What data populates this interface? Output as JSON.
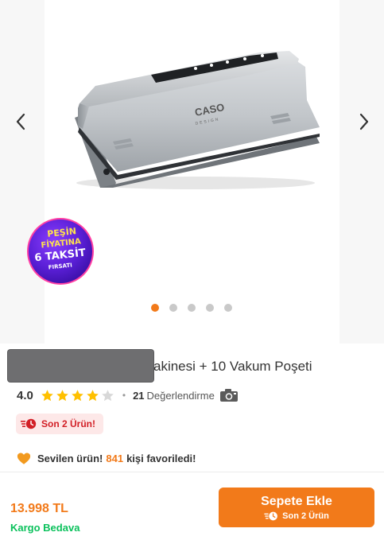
{
  "gallery": {
    "prev_icon": "chevron-left-icon",
    "next_icon": "chevron-right-icon",
    "product_logo": "CASO",
    "product_logo_sub": "DESIGN",
    "badge": {
      "line1": "PEŞİN",
      "line2": "FİYATINA",
      "line3": "6 TAKSİT",
      "line4": "FIRSATI"
    },
    "dots_total": 5,
    "active_dot": 0
  },
  "product": {
    "title_visible": "akinesi + 10 Vakum Poşeti",
    "rating": "4.0",
    "rating_value": 4,
    "review_count": "21",
    "review_label": "Değerlendirme",
    "stock_label": "Son 2 Ürün!",
    "fav_prefix": "Sevilen ürün!",
    "fav_count": "841",
    "fav_suffix": "kişi favoriledi!"
  },
  "bottom_bar": {
    "price": "13.998 TL",
    "shipping": "Kargo Bedava",
    "cart_label": "Sepete Ekle",
    "cart_sub": "Son 2 Ürün"
  },
  "colors": {
    "accent": "#f27a1a",
    "success": "#0bc15c",
    "danger": "#d21f26",
    "star_filled": "#ffc000",
    "star_empty": "#d8d8d8"
  }
}
